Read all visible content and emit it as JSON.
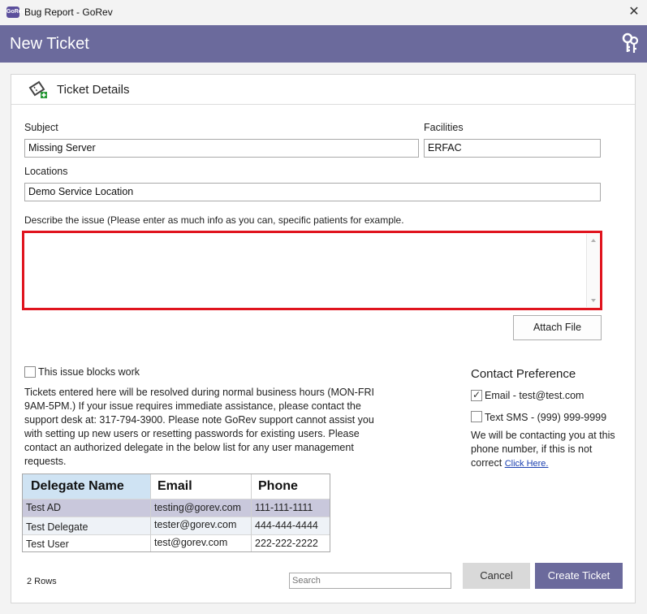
{
  "window": {
    "app_icon_text": "GoRev",
    "title": "Bug Report - GoRev",
    "close_symbol": "✕"
  },
  "header": {
    "title": "New Ticket",
    "icon": "key-icon"
  },
  "panel": {
    "title": "Ticket Details",
    "icon": "ticket-add-icon"
  },
  "form": {
    "subject": {
      "label": "Subject",
      "value": "Missing Server"
    },
    "facilities": {
      "label": "Facilities",
      "value": "ERFAC"
    },
    "locations": {
      "label": "Locations",
      "value": "Demo Service Location"
    },
    "description": {
      "label": "Describe the issue (Please enter as much info as you can, specific patients for example.",
      "value": ""
    },
    "attach_label": "Attach File",
    "blocks_work_label": "This issue blocks work",
    "blocks_work_checked": false
  },
  "info_text": "Tickets entered here will be resolved during normal business hours (MON-FRI 9AM-5PM.) If your issue requires immediate assistance, please contact the support desk at: 317-794-3900.  Please note GoRev support cannot assist you with setting up new users or resetting passwords for existing users.  Please contact an authorized delegate in the below list for any user management requests.",
  "delegates": {
    "columns": [
      "Delegate Name",
      "Email",
      "Phone"
    ],
    "rows": [
      [
        "Test AD",
        "testing@gorev.com",
        "111-111-1111"
      ],
      [
        "Test Delegate",
        "tester@gorev.com",
        "444-444-4444"
      ],
      [
        "Test User",
        "test@gorev.com",
        "222-222-2222"
      ]
    ],
    "row_count_label": "2 Rows",
    "search_placeholder": "Search"
  },
  "contact": {
    "title": "Contact Preference",
    "email_label": "Email - test@test.com",
    "email_checked": true,
    "sms_label": "Text SMS - (999) 999-9999",
    "sms_checked": false,
    "note": "We will be contacting you at this phone number, if this is not correct",
    "link": "Click Here."
  },
  "actions": {
    "cancel": "Cancel",
    "create": "Create Ticket"
  },
  "colors": {
    "header": "#6b6a9c",
    "highlight": "#e0141e",
    "header_cell": "#cfe3f3",
    "selected_row": "#c9c8dc"
  }
}
